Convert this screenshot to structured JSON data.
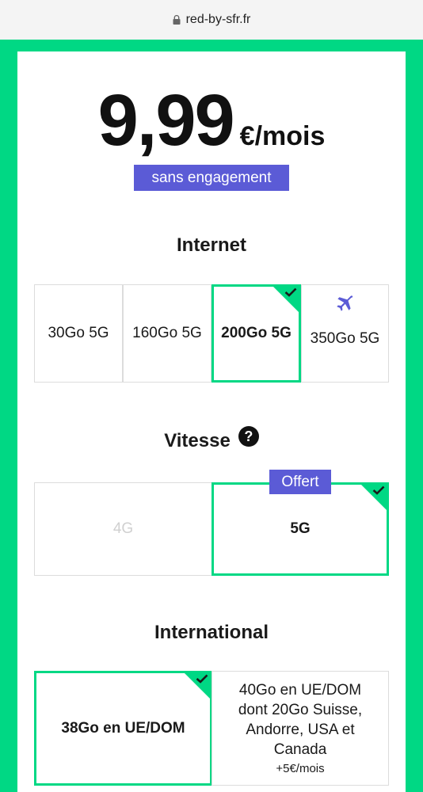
{
  "browser": {
    "url": "red-by-sfr.fr"
  },
  "offer": {
    "price": "9,99",
    "price_unit": "€/mois",
    "commitment_badge": "sans engagement"
  },
  "internet": {
    "title": "Internet",
    "options": [
      {
        "label": "30Go 5G",
        "selected": false
      },
      {
        "label": "160Go 5G",
        "selected": false
      },
      {
        "label": "200Go 5G",
        "selected": true
      },
      {
        "label": "350Go 5G",
        "selected": false,
        "icon": "airplane-icon"
      }
    ]
  },
  "vitesse": {
    "title": "Vitesse",
    "help_icon_glyph": "?",
    "options": [
      {
        "label": "4G",
        "selected": false,
        "disabled": true
      },
      {
        "label": "5G",
        "selected": true,
        "tag": "Offert"
      }
    ]
  },
  "international": {
    "title": "International",
    "options": [
      {
        "label": "38Go en UE/DOM",
        "selected": true
      },
      {
        "label_lines": [
          "40Go en UE/DOM",
          "dont 20Go Suisse,",
          "Andorre, USA et",
          "Canada"
        ],
        "price_extra": "+5€/mois",
        "selected": false
      }
    ]
  },
  "colors": {
    "accent_green": "#00d884",
    "badge_purple": "#5b5bd6"
  }
}
